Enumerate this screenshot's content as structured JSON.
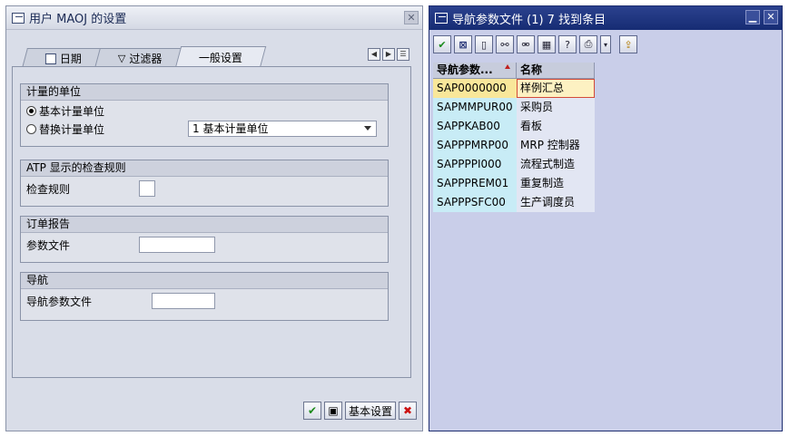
{
  "left_dialog": {
    "title": "用户 MAOJ 的设置",
    "close_glyph": "✕",
    "tabs": [
      {
        "label": "日期",
        "icon": "calendar-icon"
      },
      {
        "label": "过滤器",
        "icon": "filter-icon"
      },
      {
        "label": "一般设置",
        "icon": ""
      }
    ],
    "groups": {
      "uom": {
        "title": "计量的单位",
        "radio_base": "基本计量单位",
        "radio_alt": "替换计量单位",
        "select_value": "1 基本计量单位"
      },
      "atp": {
        "title": "ATP 显示的检查规则",
        "label": "检查规则"
      },
      "order_report": {
        "title": "订单报告",
        "label": "参数文件"
      },
      "navigation": {
        "title": "导航",
        "label": "导航参数文件"
      }
    },
    "footer": {
      "base_settings_label": "基本设置"
    }
  },
  "right_dialog": {
    "title": "导航参数文件 (1)   7 找到条目",
    "columns": [
      "导航参数...",
      "名称"
    ],
    "rows": [
      {
        "code": "SAP0000000",
        "name": "样例汇总"
      },
      {
        "code": "SAPMMPUR00",
        "name": "采购员"
      },
      {
        "code": "SAPPKAB00",
        "name": "看板"
      },
      {
        "code": "SAPPPMRP00",
        "name": "MRP 控制器"
      },
      {
        "code": "SAPPPPI000",
        "name": "流程式制造"
      },
      {
        "code": "SAPPPREM01",
        "name": "重复制造"
      },
      {
        "code": "SAPPPSFC00",
        "name": "生产调度员"
      }
    ]
  }
}
